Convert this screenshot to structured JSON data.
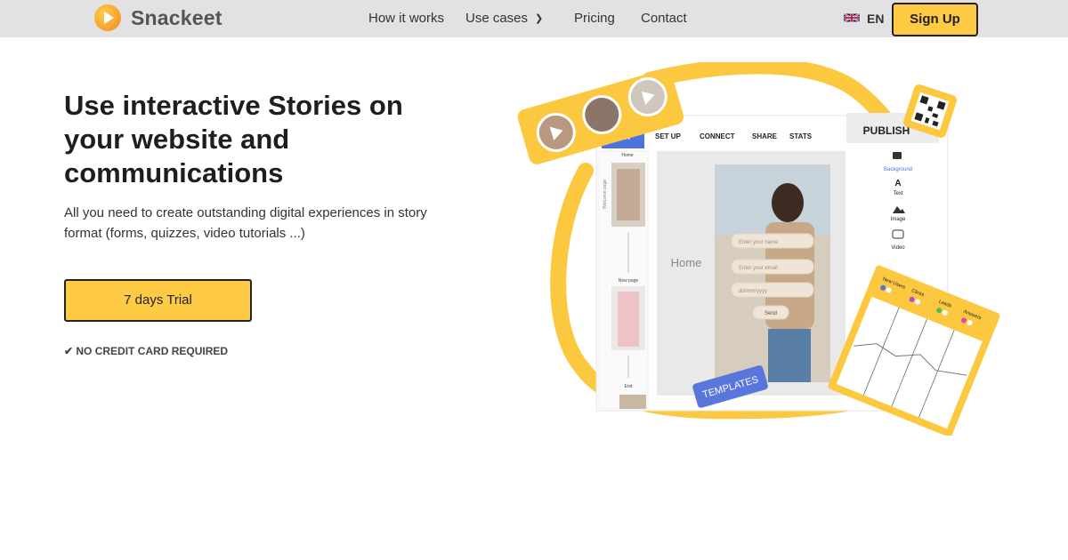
{
  "brand": {
    "name": "Snackeet",
    "logo_icon": "play-logo-icon"
  },
  "nav": {
    "links": [
      "How it works",
      "Use cases",
      "Pricing",
      "Contact"
    ],
    "language": "EN",
    "signup_label": "Sign Up"
  },
  "hero": {
    "title": "Use interactive Stories on your website and communications",
    "subtitle": "All you need to create outstanding digital experiences in story format (forms, quizzes, video tutorials ...)",
    "cta_label": "7 days Trial",
    "no_card": "✔ NO CREDIT CARD REQUIRED"
  },
  "editor": {
    "tabs": [
      "EDIT",
      "SET UP",
      "CONNECT",
      "SHARE",
      "STATS"
    ],
    "publish_label": "PUBLISH",
    "left_pages": [
      "Home",
      "New page",
      "End"
    ],
    "welcome_label": "Welcome page",
    "canvas_label": "Home",
    "form_fields": [
      "Enter your name",
      "Enter your email",
      "dd/mm/yyyy"
    ],
    "send_label": "Send",
    "tools": [
      "Background",
      "Text",
      "Image",
      "Video"
    ],
    "templates_label": "TEMPLATES",
    "stats_tags": [
      "New Users",
      "Clicks",
      "Leads",
      "Answers"
    ]
  },
  "colors": {
    "accent": "#ffcb45",
    "nav_bg": "#e2e2e2",
    "edit_tab": "#4b74e0",
    "templates_badge": "#5876dc"
  }
}
